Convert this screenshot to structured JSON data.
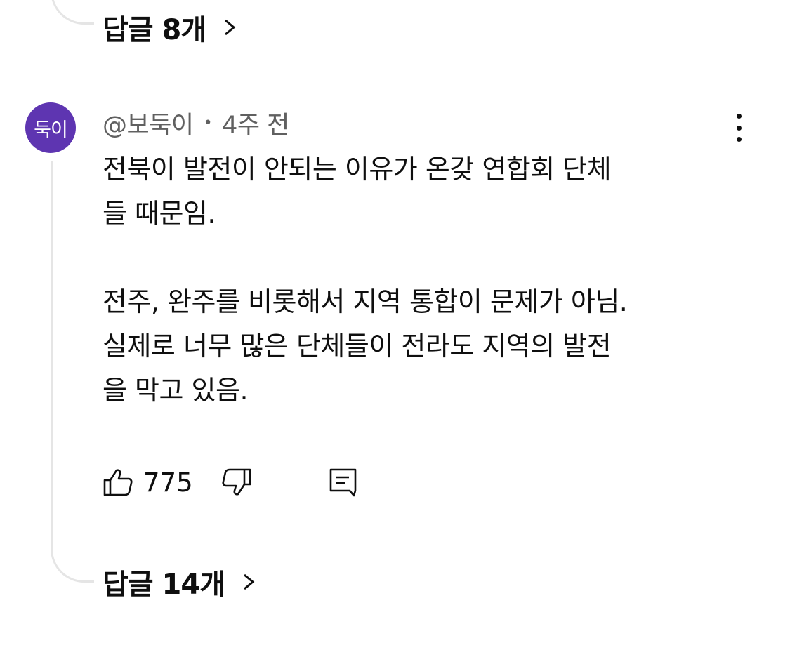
{
  "previous_thread": {
    "replies_label": "답글 8개"
  },
  "comment": {
    "avatar_text": "둑이",
    "avatar_color": "#5e35b1",
    "author": "@보둑이",
    "separator": "•",
    "time": "4주 전",
    "body_lines": [
      "전북이 발전이 안되는 이유가 온갖 연합회 단체",
      "들 때문임.",
      "",
      "전주, 완주를 비롯해서 지역 통합이 문제가 아님.",
      "실제로 너무 많은 단체들이 전라도 지역의 발전",
      "을 막고 있음."
    ],
    "likes": "775",
    "replies_label": "답글 14개"
  },
  "icons": {
    "more": "more-vertical-icon",
    "like": "thumbs-up-icon",
    "dislike": "thumbs-down-icon",
    "reply": "comment-icon",
    "chevron": "chevron-right-icon"
  }
}
